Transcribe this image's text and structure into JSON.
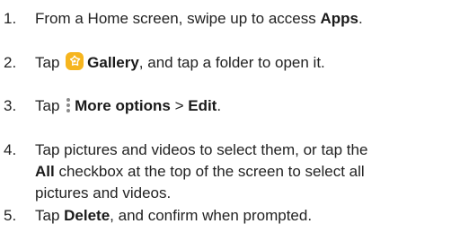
{
  "steps": [
    {
      "number": "1.",
      "pre": "From a Home screen, swipe up to access ",
      "bold": "Apps",
      "post": "."
    },
    {
      "number": "2.",
      "pre": "Tap ",
      "icon": "gallery-app-icon",
      "bold": "Gallery",
      "post": ", and tap a folder to open it."
    },
    {
      "number": "3.",
      "pre": "Tap ",
      "icon": "more-options-icon",
      "bold": "More options",
      "separator": " > ",
      "bold2": "Edit",
      "post": "."
    },
    {
      "number": "4.",
      "line1": "Tap pictures and videos to select them, or tap the",
      "bold": "All",
      "line2_post": " checkbox at the top of the screen to select all",
      "line3": "pictures and videos."
    },
    {
      "number": "5.",
      "pre": "Tap ",
      "bold": "Delete",
      "post": ", and confirm when prompted."
    }
  ],
  "colors": {
    "text": "#222222",
    "gallery_icon_bg": "#f6b51e",
    "more_options_dots": "#8a8a8a"
  }
}
